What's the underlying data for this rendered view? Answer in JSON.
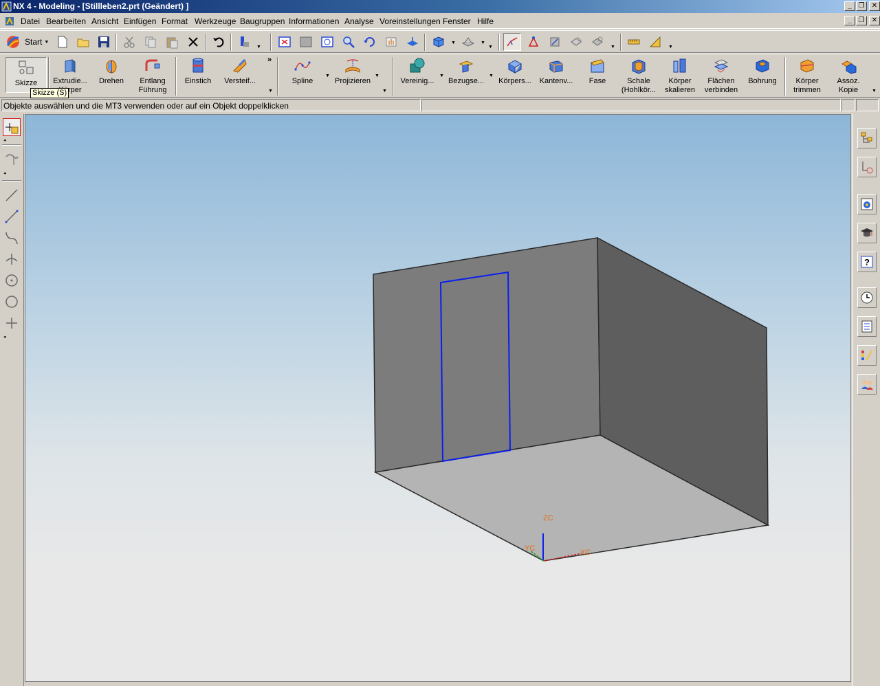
{
  "window": {
    "title": "NX 4 - Modeling - [Stillleben2.prt (Geändert) ]"
  },
  "menu": {
    "items": [
      "Datei",
      "Bearbeiten",
      "Ansicht",
      "Einfügen",
      "Format",
      "Werkzeuge",
      "Baugruppen",
      "Informationen",
      "Analyse",
      "Voreinstellungen",
      "Fenster",
      "Hilfe"
    ]
  },
  "toolbar": {
    "start_label": "Start"
  },
  "features": {
    "skizze": "Skizze",
    "extrudieren_1": "Extrudie...",
    "extrudieren_2": "Körper",
    "drehen": "Drehen",
    "entlang_1": "Entlang",
    "entlang_2": "Führung",
    "einstich": "Einstich",
    "versteifung": "Versteif...",
    "spline": "Spline",
    "projizieren": "Projizieren",
    "vereinigen": "Vereinig...",
    "bezug": "Bezugse...",
    "koerpers": "Körpers...",
    "kantenv": "Kantenv...",
    "fase": "Fase",
    "schale_1": "Schale",
    "schale_2": "(Hohlkör...",
    "koerper_skal_1": "Körper",
    "koerper_skal_2": "skalieren",
    "flaechen_1": "Flächen",
    "flaechen_2": "verbinden",
    "bohrung": "Bohrung",
    "koerper_trim_1": "Körper",
    "koerper_trim_2": "trimmen",
    "assoz_1": "Assoz.",
    "assoz_2": "Kopie"
  },
  "tooltip": "Skizze (S)",
  "status": {
    "message": "Objekte auswählen und die MT3 verwenden oder auf ein Objekt doppelklicken"
  },
  "axes": {
    "zc": "ZC",
    "yc": "YC",
    "xc": "XC"
  },
  "colors": {
    "sketch_line": "#0a1ef0",
    "axis_label": "#e86a10",
    "title_bar_start": "#0a246a",
    "face_back": "#7c7c7c",
    "face_right": "#5e5e5e",
    "face_floor": "#b4b4b4"
  }
}
